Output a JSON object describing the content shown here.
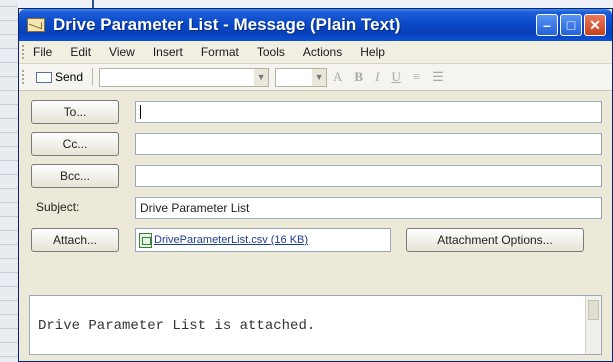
{
  "window": {
    "title": "Drive Parameter List - Message (Plain Text)"
  },
  "menu": [
    "File",
    "Edit",
    "View",
    "Insert",
    "Format",
    "Tools",
    "Actions",
    "Help"
  ],
  "toolbar": {
    "send_label": "Send",
    "format_buttons": [
      "A",
      "B",
      "I",
      "U"
    ]
  },
  "form": {
    "to_label": "To...",
    "to_value": "",
    "cc_label": "Cc...",
    "cc_value": "",
    "bcc_label": "Bcc...",
    "bcc_value": "",
    "subject_label": "Subject:",
    "subject_value": "Drive Parameter List",
    "attach_label": "Attach...",
    "attachment_name": "DriveParameterList.csv (16 KB)",
    "attachment_options_label": "Attachment Options..."
  },
  "body": {
    "text": "Drive Parameter List is attached."
  }
}
